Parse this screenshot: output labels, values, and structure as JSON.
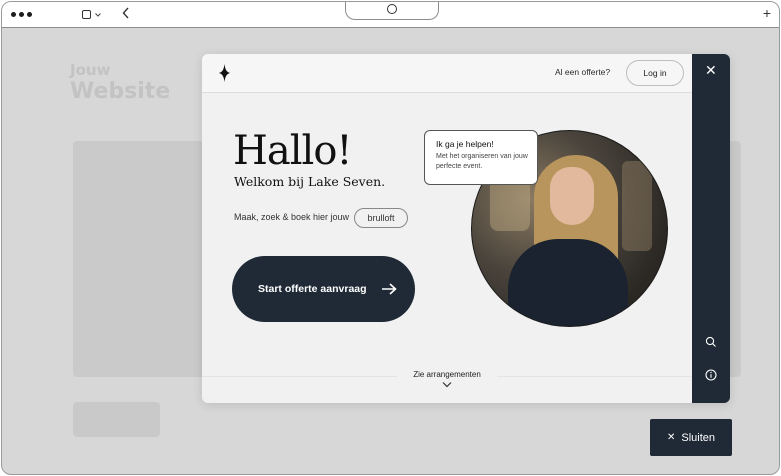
{
  "browser": {
    "window_controls": [
      "dot",
      "dot",
      "dot"
    ],
    "tab_icon": "tab-square-icon",
    "back_icon": "chevron-left-icon",
    "camera_icon": "camera-icon",
    "new_tab_icon": "plus-icon",
    "new_tab_glyph": "+"
  },
  "background_site": {
    "title_line1": "Jouw",
    "title_line2": "Website"
  },
  "widget": {
    "header": {
      "logo_icon": "diamond-star-icon",
      "quote_prompt": "Al een offerte?",
      "login_label": "Log in"
    },
    "rail": {
      "close_glyph": "✕",
      "search_icon": "search-icon",
      "info_icon": "info-icon"
    },
    "greeting": "Hallo!",
    "welcome": "Welkom bij Lake Seven.",
    "search_prompt": "Maak, zoek & boek hier jouw",
    "search_chip": "brulloft",
    "cta_label": "Start offerte aanvraag",
    "bubble": {
      "title": "Ik ga je helpen!",
      "text": "Met het organiseren van jouw perfecte event."
    },
    "arrangements_label": "Zie arrangementen"
  },
  "close_widget": {
    "glyph": "✕",
    "label": "Sluiten"
  },
  "colors": {
    "navy": "#1f2a36",
    "page_bg": "#d7d7d7",
    "widget_bg": "#f1f1f1"
  }
}
